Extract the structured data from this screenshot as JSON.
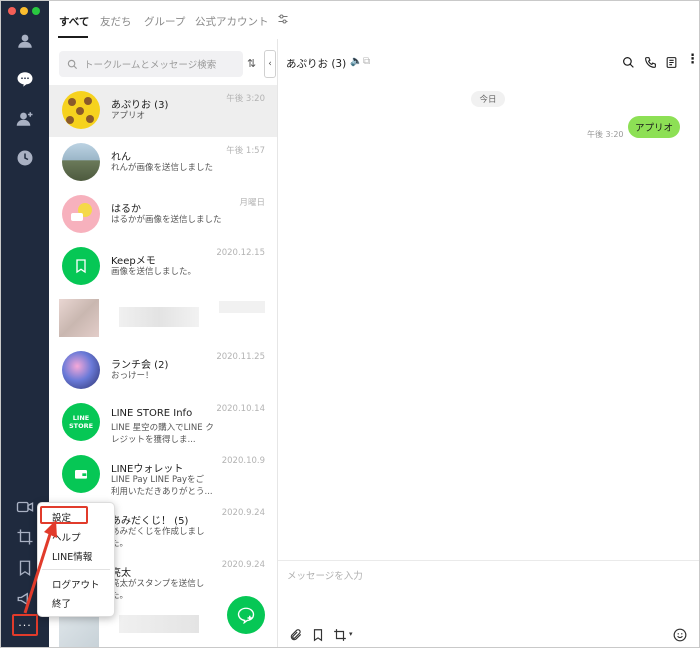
{
  "tabs": [
    {
      "label": "すべて"
    },
    {
      "label": "友だち"
    },
    {
      "label": "グループ"
    },
    {
      "label": "公式アカウント"
    }
  ],
  "search": {
    "placeholder": "トークルームとメッセージ検索"
  },
  "chats": [
    {
      "name": "あぷりお (3)",
      "message": "アプリオ",
      "time": "午後 3:20"
    },
    {
      "name": "れん",
      "message": "れんが画像を送信しました",
      "time": "午後 1:57"
    },
    {
      "name": "はるか",
      "message": "はるかが画像を送信しました",
      "time": "月曜日"
    },
    {
      "name": "Keepメモ",
      "message": "画像を送信しました。",
      "time": "2020.12.15"
    },
    {
      "name": "ランチ会 (2)",
      "message": "おっけー！",
      "time": "2020.11.25"
    },
    {
      "name": "LINE STORE Info",
      "message": "LINE 星空の購入でLINE クレジットを獲得しま...",
      "time": "2020.10.14"
    },
    {
      "name": "LINEウォレット",
      "message": "LINE Pay LINE Payをご 利用いただきありがとう...",
      "time": "2020.10.9"
    },
    {
      "name": "あみだくじ！ (5)",
      "message": "あみだくじを作成しまし た。",
      "time": "2020.9.24"
    },
    {
      "name": "亮太",
      "message": "亮太がスタンプを送信し た。",
      "time": "2020.9.24"
    }
  ],
  "avatar_labels": {
    "line_store": "LINE STORE"
  },
  "conversation": {
    "title": "あぷりお (3)",
    "date_label": "今日",
    "messages": [
      {
        "text": "アプリオ",
        "time": "午後 3:20"
      }
    ],
    "composer_placeholder": "メッセージを入力"
  },
  "menu_button": {
    "label": "···"
  },
  "context_menu": {
    "items": [
      {
        "label": "設定"
      },
      {
        "label": "ヘルプ"
      },
      {
        "label": "LINE情報"
      },
      {
        "label": "ログアウト"
      },
      {
        "label": "終了"
      }
    ]
  },
  "colors": {
    "sidebar": "#1f2a3e",
    "line_green": "#06c755",
    "bubble_green": "#8de055",
    "highlight_red": "#e13b2b"
  }
}
